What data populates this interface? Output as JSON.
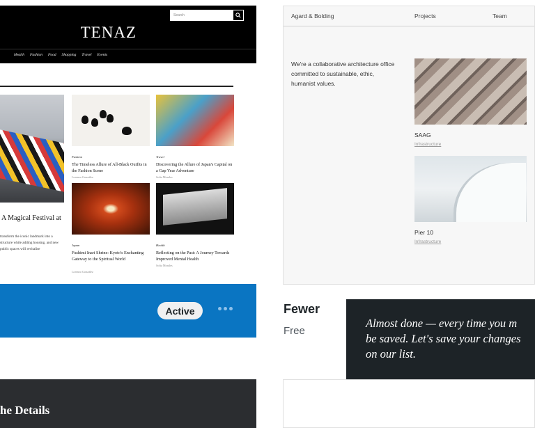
{
  "left_theme": {
    "preview": {
      "search_placeholder": "Search",
      "logo": "TENAZ",
      "nav": [
        "Health",
        "Fashion",
        "Food",
        "Shopping",
        "Travel",
        "Events"
      ],
      "feature": {
        "title": "A Magical Festival at",
        "excerpt": "transform the iconic landmark into a structure while adding housing, and new public spaces will revitalise"
      },
      "articles": [
        {
          "category": "Fashion",
          "title": "The Timeless Allure of All-Black Outfits in the Fashion Scene",
          "author": "Lorenzo González"
        },
        {
          "category": "Travel",
          "title": "Discovering the Allure of Japan's Capital on a Gap Year Adventure",
          "author": "Sofia Morales"
        },
        {
          "category": "Japan",
          "title": "Fushimi Inari Shrine: Kyoto's Enchanting Gateway to the Spiritual World",
          "author": "Lorenzo González"
        },
        {
          "category": "Health",
          "title": "Reflecting on the Past: A Journey Towards Improved Mental Health",
          "author": "Sofia Morales"
        }
      ]
    },
    "status_label": "Active",
    "accent_color": "#0a75c2"
  },
  "dark_card": {
    "title": "he Details"
  },
  "right_theme": {
    "preview": {
      "nav": [
        "Agard & Bolding",
        "Projects",
        "Team"
      ],
      "intro": "We're a collaborative architecture office committed to sustainable, ethic, humanist values.",
      "projects": [
        {
          "name": "SAAG",
          "category": "Infrastructure"
        },
        {
          "name": "Pier 10",
          "category": "Infrastructure"
        }
      ]
    },
    "name": "Fewer",
    "price": "Free"
  },
  "toast": {
    "message": "Almost done — every time you m\nbe saved. Let's save your changes\non our list."
  }
}
